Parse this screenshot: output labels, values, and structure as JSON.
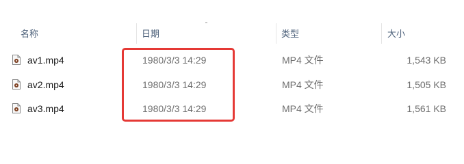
{
  "columns": {
    "name": "名称",
    "date": "日期",
    "type": "类型",
    "size": "大小"
  },
  "files": [
    {
      "name": "av1.mp4",
      "date": "1980/3/3 14:29",
      "type": "MP4 文件",
      "size": "1,543 KB",
      "icon": "video-file-icon"
    },
    {
      "name": "av2.mp4",
      "date": "1980/3/3 14:29",
      "type": "MP4 文件",
      "size": "1,505 KB",
      "icon": "video-file-icon"
    },
    {
      "name": "av3.mp4",
      "date": "1980/3/3 14:29",
      "type": "MP4 文件",
      "size": "1,561 KB",
      "icon": "video-file-icon"
    }
  ],
  "colors": {
    "highlight": "#e53935",
    "header_text": "#4c607a",
    "secondary_text": "#6d6d6d"
  }
}
